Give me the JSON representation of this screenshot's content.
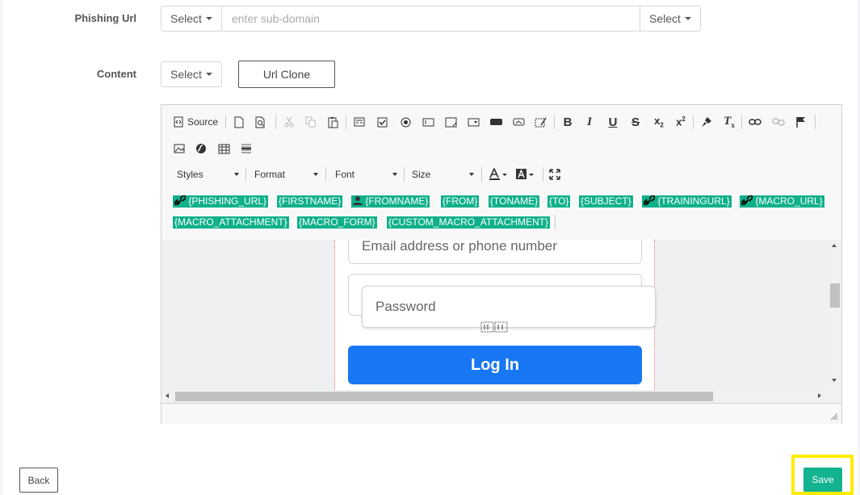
{
  "form": {
    "phishing_url_label": "Phishing Url",
    "content_label": "Content",
    "select_label": "Select",
    "subdomain_placeholder": "enter sub-domain",
    "url_clone_label": "Url Clone"
  },
  "editor": {
    "source_label": "Source",
    "styles_label": "Styles",
    "format_label": "Format",
    "font_label": "Font",
    "size_label": "Size",
    "tags": [
      "{PHISHING_URL}",
      "{FIRSTNAME}",
      "{FROMNAME}",
      "{FROM}",
      "{TONAME}",
      "{TO}",
      "{SUBJECT}",
      "{TRAININGURL}",
      "{MACRO_URL}",
      "{MACRO_ATTACHMENT}",
      "{MACRO_FORM}",
      "{CUSTOM_MACRO_ATTACHMENT}"
    ],
    "preview": {
      "email_placeholder": "Email address or phone number",
      "password_placeholder": "Password",
      "login_label": "Log In"
    }
  },
  "footer": {
    "back_label": "Back",
    "save_label": "Save"
  },
  "colors": {
    "tag_bg": "#0fb08a",
    "save_bg": "#12b38e",
    "login_bg": "#1877f2",
    "highlight": "#ffeb00"
  }
}
